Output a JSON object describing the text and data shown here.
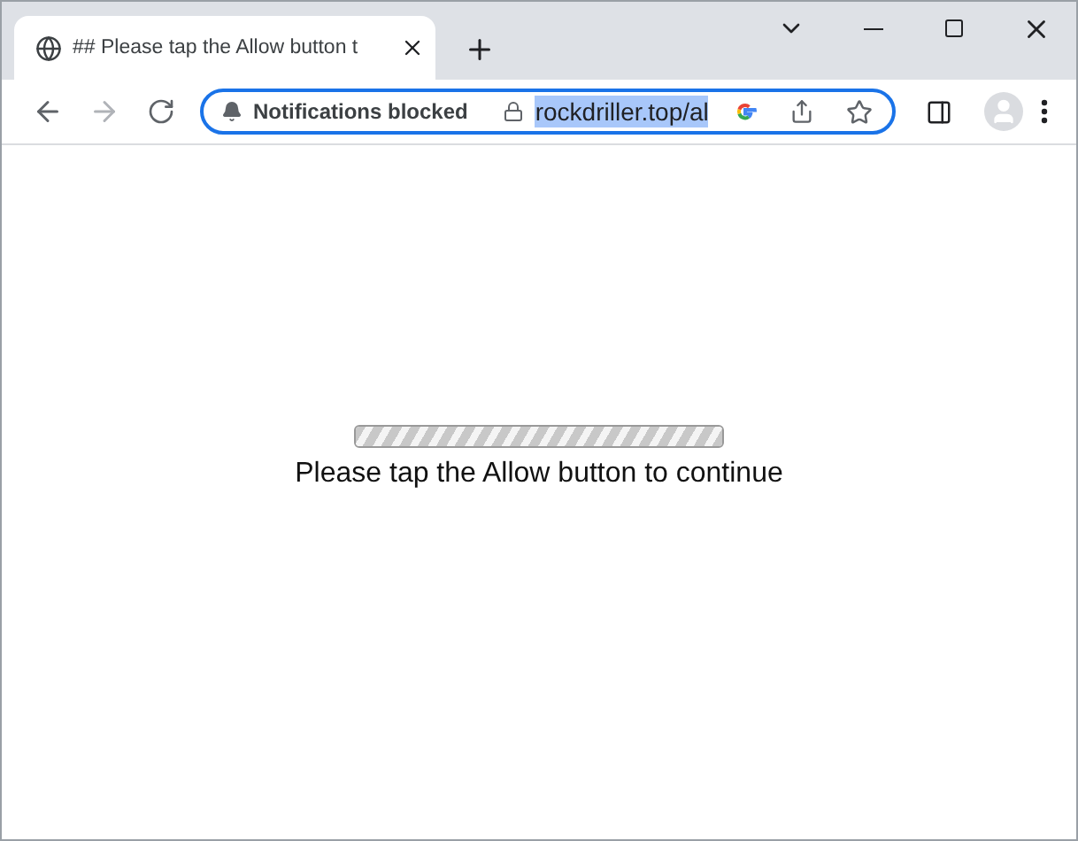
{
  "tab": {
    "title": "## Please tap the Allow button t",
    "selected": true
  },
  "address_bar": {
    "permission_chip": "Notifications blocked",
    "url": "rockdriller.top/al",
    "url_selected": true
  },
  "page": {
    "progress": {
      "level": 1
    },
    "message": "Please tap the Allow button to continue"
  }
}
